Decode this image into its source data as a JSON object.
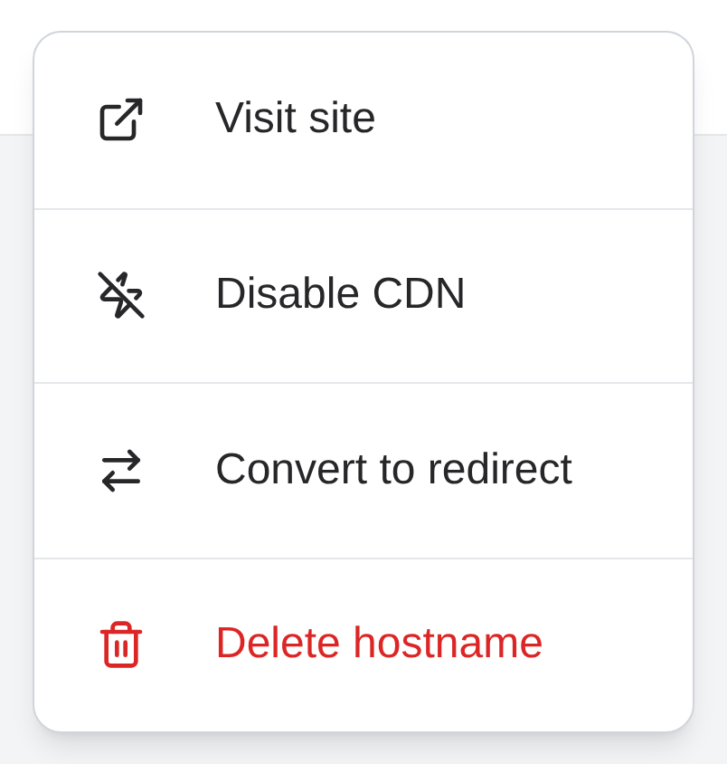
{
  "menu": {
    "items": [
      {
        "kind": "link",
        "label": "Visit site",
        "danger": false
      },
      {
        "kind": "cdn",
        "label": "Disable CDN",
        "danger": false
      },
      {
        "kind": "redirect",
        "label": "Convert to redirect",
        "danger": false
      },
      {
        "kind": "delete",
        "label": "Delete hostname",
        "danger": true
      }
    ]
  }
}
